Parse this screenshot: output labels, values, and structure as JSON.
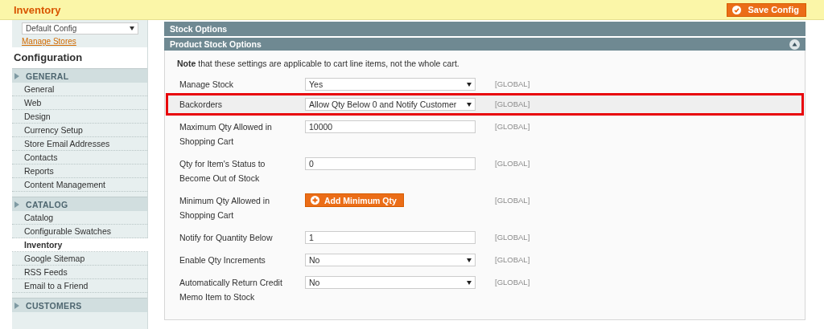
{
  "header": {
    "title": "Inventory",
    "save_button": "Save Config"
  },
  "scope_switcher": {
    "value": "Default Config"
  },
  "manage_stores_link": "Manage Stores",
  "sidebar": {
    "title": "Configuration",
    "sections": [
      {
        "label": "GENERAL",
        "items": [
          {
            "label": "General",
            "selected": false
          },
          {
            "label": "Web",
            "selected": false
          },
          {
            "label": "Design",
            "selected": false
          },
          {
            "label": "Currency Setup",
            "selected": false
          },
          {
            "label": "Store Email Addresses",
            "selected": false
          },
          {
            "label": "Contacts",
            "selected": false
          },
          {
            "label": "Reports",
            "selected": false
          },
          {
            "label": "Content Management",
            "selected": false
          }
        ]
      },
      {
        "label": "CATALOG",
        "items": [
          {
            "label": "Catalog",
            "selected": false
          },
          {
            "label": "Configurable Swatches",
            "selected": false
          },
          {
            "label": "Inventory",
            "selected": true
          },
          {
            "label": "Google Sitemap",
            "selected": false
          },
          {
            "label": "RSS Feeds",
            "selected": false
          },
          {
            "label": "Email to a Friend",
            "selected": false
          }
        ]
      },
      {
        "label": "CUSTOMERS"
      }
    ]
  },
  "main": {
    "outer_title": "Stock Options",
    "group": {
      "title": "Product Stock Options",
      "expanded": true,
      "note": "**Note** that these settings are applicable to cart line items, not the whole cart.",
      "rows": [
        {
          "label": "Manage Stock",
          "kind": "select",
          "value": "Yes",
          "scope": "[GLOBAL]",
          "highlighted": false
        },
        {
          "label": "Backorders",
          "kind": "select",
          "value": "Allow Qty Below 0 and Notify Customer",
          "scope": "[GLOBAL]",
          "highlighted": true
        },
        {
          "label": "Maximum Qty Allowed in Shopping Cart",
          "kind": "input",
          "value": "10000",
          "scope": "[GLOBAL]",
          "highlighted": false
        },
        {
          "label": "Qty for Item's Status to Become Out of Stock",
          "kind": "input",
          "value": "0",
          "scope": "[GLOBAL]",
          "highlighted": false
        },
        {
          "label": "Minimum Qty Allowed in Shopping Cart",
          "kind": "button",
          "value": "Add Minimum Qty",
          "scope": "[GLOBAL]",
          "highlighted": false
        },
        {
          "label": "Notify for Quantity Below",
          "kind": "input",
          "value": "1",
          "scope": "[GLOBAL]",
          "highlighted": false
        },
        {
          "label": "Enable Qty Increments",
          "kind": "select",
          "value": "No",
          "scope": "[GLOBAL]",
          "highlighted": false
        },
        {
          "label": "Automatically Return Credit Memo Item to Stock",
          "kind": "select",
          "value": "No",
          "scope": "[GLOBAL]",
          "highlighted": false
        }
      ]
    }
  }
}
